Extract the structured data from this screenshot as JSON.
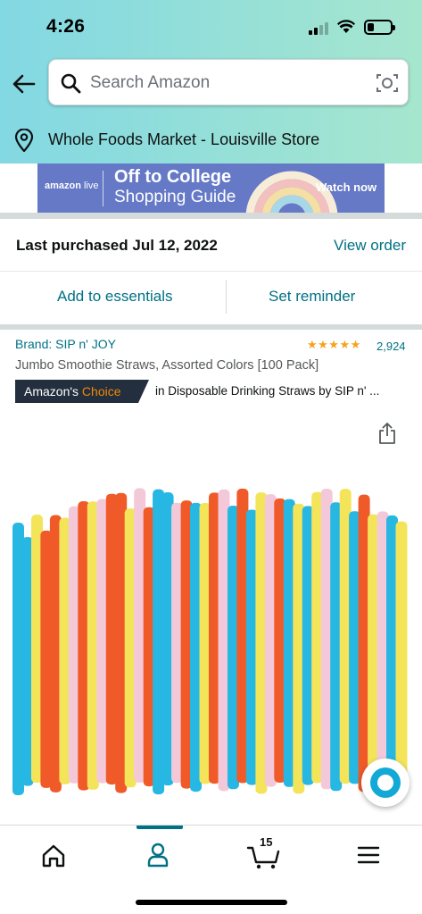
{
  "status": {
    "time": "4:26"
  },
  "search": {
    "placeholder": "Search Amazon"
  },
  "location": {
    "label": "Whole Foods Market - Louisville Store"
  },
  "banner": {
    "logo_brand": "amazon",
    "logo_live": "live",
    "title": "Off to College",
    "subtitle": "Shopping Guide",
    "cta": "Watch now"
  },
  "purchase": {
    "label": "Last purchased Jul 12, 2022",
    "view_order": "View order",
    "add_essentials": "Add to essentials",
    "set_reminder": "Set reminder"
  },
  "product": {
    "brand": "Brand: SIP n' JOY",
    "stars": "★★★★★",
    "rating": 4.5,
    "review_count": "2,924",
    "title": "Jumbo Smoothie Straws, Assorted Colors [100 Pack]",
    "badge_prefix": "Amazon's",
    "badge_choice": "Choice",
    "badge_category": "in Disposable Drinking Straws by SIP n' ..."
  },
  "bottom_nav": {
    "cart_count": "15",
    "active": "account",
    "items": [
      "home-icon",
      "account-icon",
      "cart-icon",
      "menu-icon"
    ]
  },
  "colors": {
    "link": "#007185",
    "star": "#f7a21b",
    "badge_bg": "#232f3e",
    "badge_accent": "#f08804",
    "banner_bg": "#6579c6",
    "header_gradient": [
      "#82d8e3",
      "#a6e6ce"
    ],
    "straws": [
      "#27b7e3",
      "#f05a28",
      "#f3e45a",
      "#f3c9d9"
    ]
  }
}
